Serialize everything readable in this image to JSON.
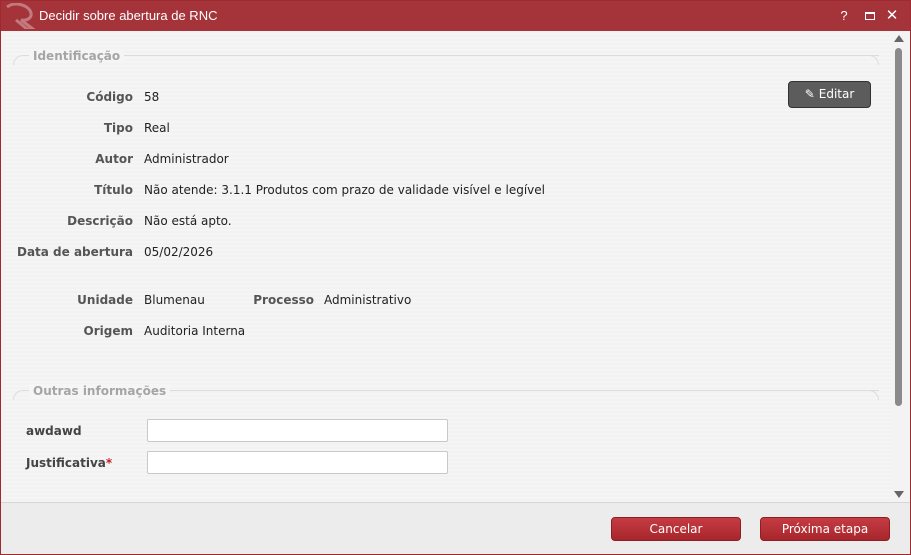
{
  "dialog": {
    "title": "Decidir sobre abertura de RNC",
    "help_label": "?",
    "close_label": "✕"
  },
  "identificacao": {
    "legend": "Identificação",
    "edit_label": "Editar",
    "fields": [
      {
        "label": "Código",
        "value": "58"
      },
      {
        "label": "Tipo",
        "value": "Real"
      },
      {
        "label": "Autor",
        "value": "Administrador"
      },
      {
        "label": "Título",
        "value": "Não atende: 3.1.1 Produtos com prazo de validade visível e legível"
      },
      {
        "label": "Descrição",
        "value": "Não está apto."
      },
      {
        "label": "Data de abertura",
        "value": "05/02/2026"
      }
    ],
    "unidade": {
      "label": "Unidade",
      "value": "Blumenau"
    },
    "processo": {
      "label": "Processo",
      "value": "Administrativo"
    },
    "origem": {
      "label": "Origem",
      "value": "Auditoria Interna"
    }
  },
  "outras": {
    "legend": "Outras informações",
    "awdawd": {
      "label": "awdawd",
      "value": ""
    },
    "justificativa": {
      "label": "Justificativa",
      "required_mark": "*",
      "value": ""
    }
  },
  "footer": {
    "cancel_label": "Cancelar",
    "next_label": "Próxima etapa"
  },
  "colors": {
    "title_bar": "#a4343a",
    "button_red": "#b52f36",
    "edit_button": "#5c5c5c"
  }
}
